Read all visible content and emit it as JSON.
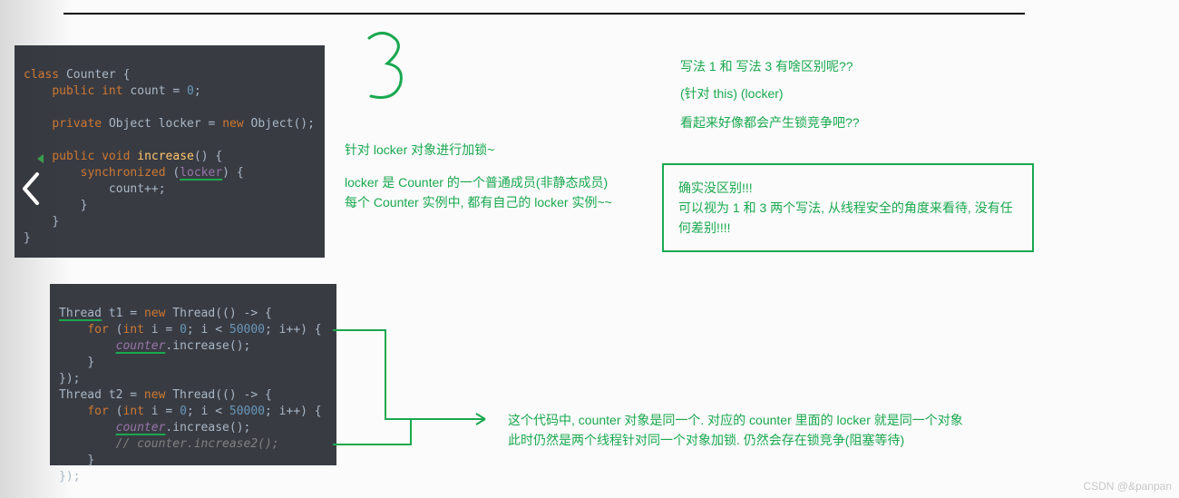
{
  "colors": {
    "green": "#1aa84f",
    "codeBg": "#2b2d33"
  },
  "big_numeral": "3",
  "code1": {
    "l1_kw": "class",
    "l1_name": "Counter",
    "l1_tail": " {",
    "l2_mod": "public ",
    "l2_type": "int ",
    "l2_rest": "count = ",
    "l2_num": "0",
    "l2_semi": ";",
    "l3_mod": "private ",
    "l3_type": "Object ",
    "l3_rest": "locker = ",
    "l3_new": "new ",
    "l3_ctor": "Object",
    "l3_tail": "();",
    "l4_mod": "public ",
    "l4_ret": "void ",
    "l4_fn": "increase",
    "l4_tail": "() {",
    "l5_kw": "synchronized ",
    "l5_open": "(",
    "l5_var": "locker",
    "l5_close": ") {",
    "l6": "count++;",
    "l7": "}",
    "l8": "}",
    "l9": "}"
  },
  "annotA": {
    "line1": "针对 locker 对象进行加锁~",
    "line2": "locker 是 Counter 的一个普通成员(非静态成员)",
    "line3": "每个 Counter 实例中, 都有自己的 locker 实例~~"
  },
  "question": {
    "line1": "写法 1  和 写法 3 有啥区别呢??",
    "line2": "(针对 this)   (locker)",
    "line3": "看起来好像都会产生锁竞争吧??"
  },
  "answer": {
    "line1": "确实没区别!!!",
    "line2": "可以视为 1 和 3 两个写法, 从线程安全的角度来看待, 没有任何差别!!!!"
  },
  "code2": {
    "a1": "Thread t1 = ",
    "a1_new": "new ",
    "a1_ctor": "Thread",
    "a1_tail": "(() -> {",
    "b_for": "for ",
    "b_open": "(",
    "b_int": "int ",
    "b_iter": "i = ",
    "b_zero": "0",
    "b_semi1": "; i < ",
    "b_lim": "50000",
    "b_rest": "; i++) {",
    "c_obj": "counter",
    "c_tail": ".increase();",
    "d": "}",
    "e": "});",
    "f1": "Thread t2 = ",
    "f1_new": "new ",
    "f1_ctor": "Thread",
    "f1_tail": "(() -> {",
    "g_for": "for ",
    "g_open": "(",
    "g_int": "int ",
    "g_iter": "i = ",
    "g_zero": "0",
    "g_semi1": "; i < ",
    "g_lim": "50000",
    "g_rest": "; i++) {",
    "h_obj": "counter",
    "h_tail": ".increase();",
    "i_cmt": "// counter.increase2();",
    "j": "}",
    "k": "});"
  },
  "annotB": {
    "line1": "这个代码中, counter 对象是同一个. 对应的 counter 里面的 locker 就是同一个对象",
    "line2": "此时仍然是两个线程针对同一个对象加锁. 仍然会存在锁竞争(阻塞等待)"
  },
  "watermark": "CSDN @&panpan"
}
